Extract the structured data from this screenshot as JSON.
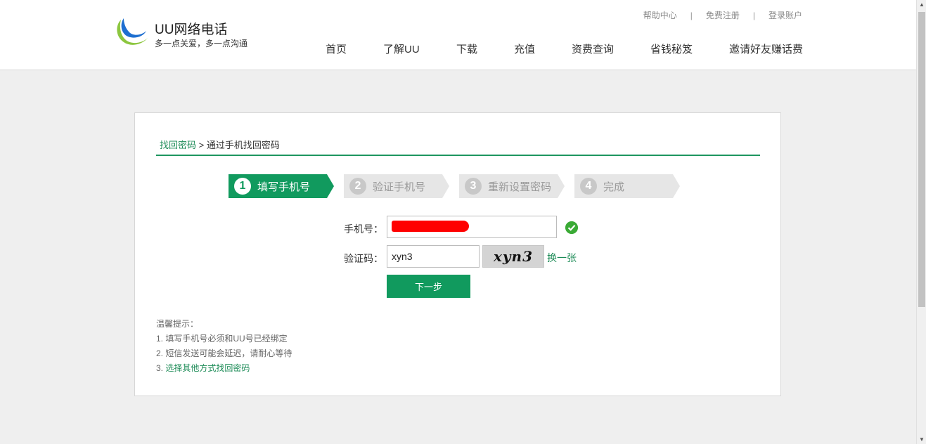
{
  "brand": {
    "name": "UU网络电话",
    "slogan": "多一点关爱，多一点沟通",
    "colors": {
      "green": "#119a5e",
      "blue": "#1a5fbf"
    }
  },
  "toplinks": [
    "帮助中心",
    "免费注册",
    "登录账户"
  ],
  "nav": [
    "首页",
    "了解UU",
    "下载",
    "充值",
    "资费查询",
    "省钱秘笈",
    "邀请好友赚话费"
  ],
  "breadcrumb": {
    "link": "找回密码",
    "current": " > 通过手机找回密码"
  },
  "steps": [
    {
      "num": "1",
      "label": "填写手机号",
      "active": true
    },
    {
      "num": "2",
      "label": "验证手机号",
      "active": false
    },
    {
      "num": "3",
      "label": "重新设置密码",
      "active": false
    },
    {
      "num": "4",
      "label": "完成",
      "active": false
    }
  ],
  "form": {
    "phone_label": "手机号：",
    "phone_value": "",
    "code_label": "验证码：",
    "code_value": "xyn3",
    "captcha_text": "xyn3",
    "refresh_label": "换一张",
    "next_label": "下一步"
  },
  "tips": {
    "title": "温馨提示：",
    "items": [
      "1. 填写手机号必须和UU号已经绑定",
      "2. 短信发送可能会延迟，请耐心等待"
    ],
    "item3_prefix": "3. ",
    "item3_link": "选择其他方式找回密码"
  }
}
